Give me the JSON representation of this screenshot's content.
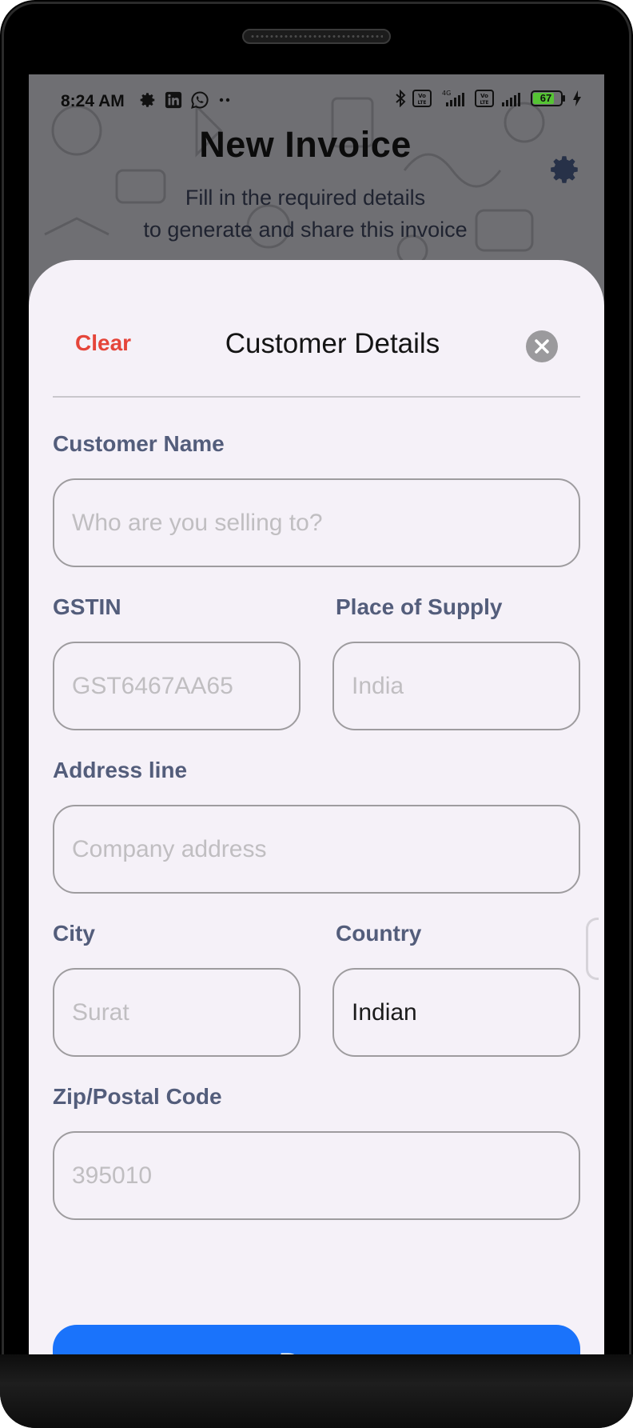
{
  "status_bar": {
    "time": "8:24 AM",
    "battery": "67",
    "left_icons": [
      "gear-icon",
      "linkedin-icon",
      "whatsapp-icon",
      "more-dots-icon"
    ],
    "right_icons": [
      "bluetooth-icon",
      "volte-icon",
      "signal-4g-icon",
      "volte-icon",
      "signal-icon",
      "battery-icon",
      "charging-icon"
    ]
  },
  "header": {
    "title": "New Invoice",
    "subtitle": "Fill in the required details\nto generate and share this invoice"
  },
  "sheet": {
    "clear_label": "Clear",
    "title": "Customer Details",
    "fields": {
      "customer_name": {
        "label": "Customer Name",
        "placeholder": "Who are you selling to?",
        "value": ""
      },
      "gstin": {
        "label": "GSTIN",
        "placeholder": "GST6467AA65",
        "value": ""
      },
      "place_of_supply": {
        "label": "Place of Supply",
        "placeholder": "India",
        "value": ""
      },
      "address_line": {
        "label": "Address line",
        "placeholder": "Company address",
        "value": ""
      },
      "city": {
        "label": "City",
        "placeholder": "Surat",
        "value": ""
      },
      "country": {
        "label": "Country",
        "placeholder": "",
        "value": "Indian"
      },
      "zip": {
        "label": "Zip/Postal Code",
        "placeholder": "395010",
        "value": ""
      }
    },
    "done_label": "Done"
  },
  "colors": {
    "accent": "#1a73fb",
    "clear": "#e5453a",
    "label": "#535d7b",
    "sheet_bg": "#f5f1f8",
    "battery_fill": "#55c434"
  }
}
